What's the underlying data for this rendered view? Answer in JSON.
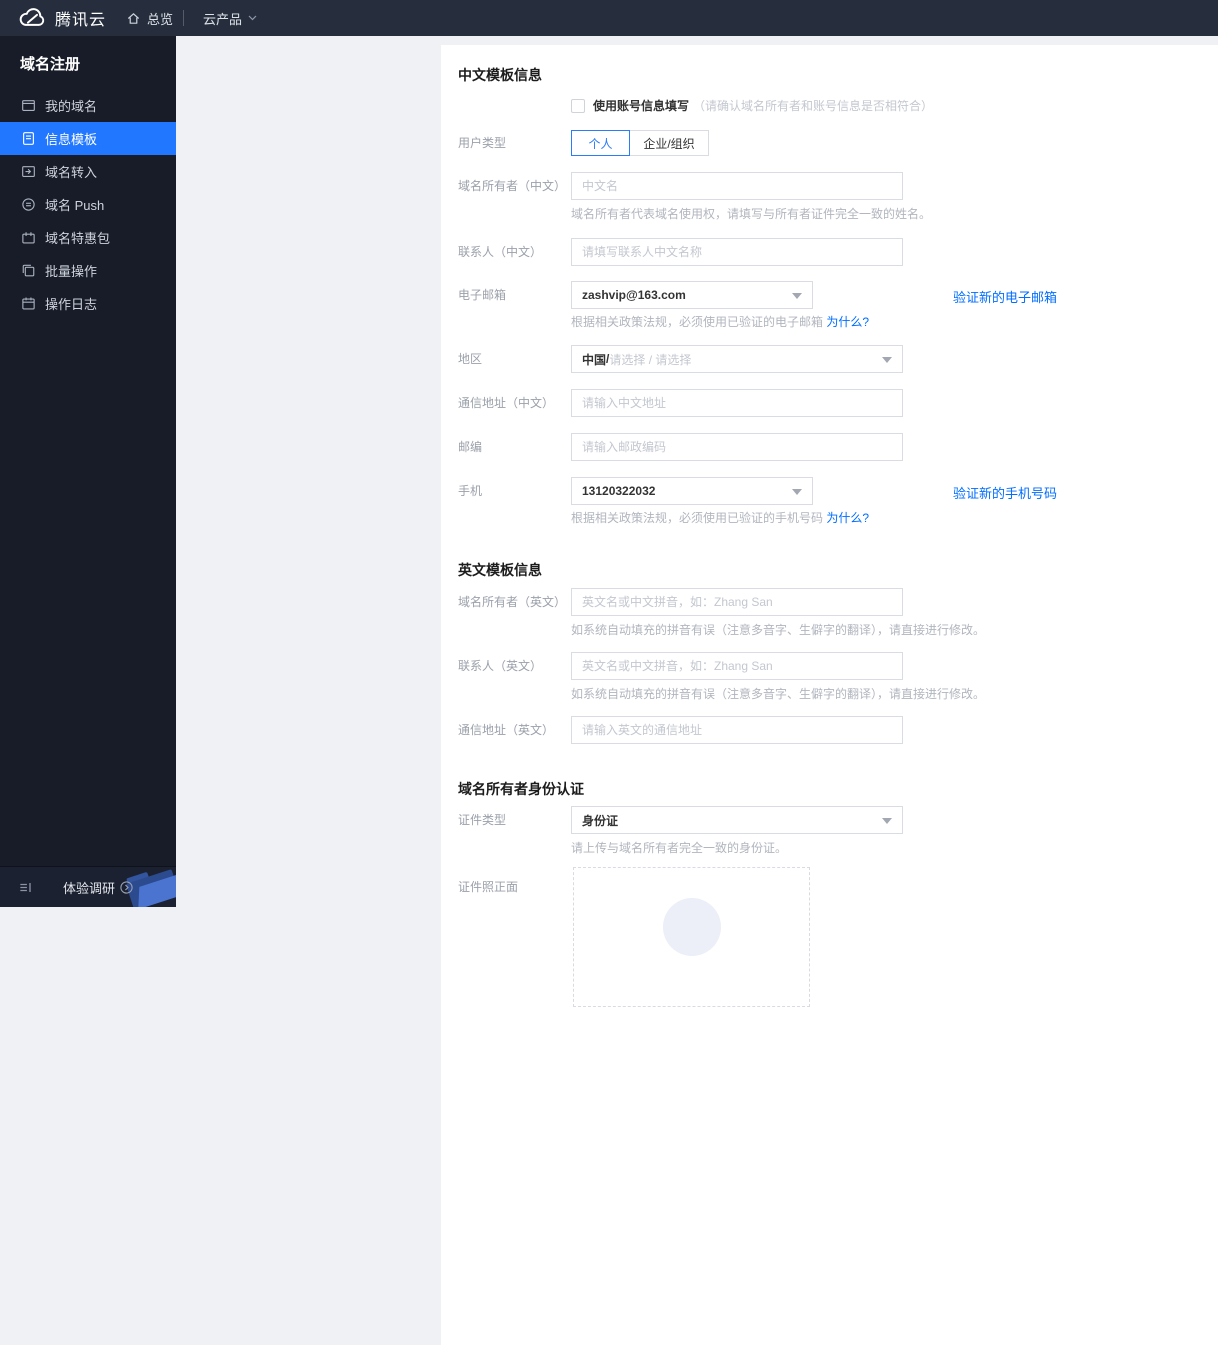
{
  "colors": {
    "accent": "#2b7cf8",
    "sidebar_active": "#2177ff",
    "link": "#006eff",
    "topbar_bg": "#262e3d",
    "sidebar_bg": "#171c28"
  },
  "topbar": {
    "brand": "腾讯云",
    "overview": "总览",
    "products": "云产品"
  },
  "sidebar": {
    "title": "域名注册",
    "items": [
      {
        "label": "我的域名"
      },
      {
        "label": "信息模板"
      },
      {
        "label": "域名转入"
      },
      {
        "label": "域名 Push"
      },
      {
        "label": "域名特惠包"
      },
      {
        "label": "批量操作"
      },
      {
        "label": "操作日志"
      }
    ],
    "survey_label": "体验调研"
  },
  "form": {
    "cn": {
      "title": "中文模板信息",
      "use_account": {
        "label": "使用账号信息填写",
        "note": "（请确认域名所有者和账号信息是否相符合）"
      },
      "user_type": {
        "label": "用户类型",
        "personal": "个人",
        "org": "企业/组织"
      },
      "owner": {
        "label": "域名所有者（中文）",
        "placeholder": "中文名",
        "help": "域名所有者代表域名使用权，请填写与所有者证件完全一致的姓名。"
      },
      "contact": {
        "label": "联系人（中文）",
        "placeholder": "请填写联系人中文名称"
      },
      "email": {
        "label": "电子邮箱",
        "value": "zashvip@163.com",
        "action": "验证新的电子邮箱",
        "help": "根据相关政策法规，必须使用已验证的电子邮箱",
        "why": "为什么?"
      },
      "region": {
        "label": "地区",
        "selected": "中国",
        "separator": " / ",
        "placeholder": "请选择 / 请选择"
      },
      "address": {
        "label": "通信地址（中文）",
        "placeholder": "请输入中文地址"
      },
      "postcode": {
        "label": "邮编",
        "placeholder": "请输入邮政编码"
      },
      "phone": {
        "label": "手机",
        "value": "13120322032",
        "action": "验证新的手机号码",
        "help": "根据相关政策法规，必须使用已验证的手机号码",
        "why": "为什么?"
      }
    },
    "en": {
      "title": "英文模板信息",
      "owner": {
        "label": "域名所有者（英文）",
        "placeholder": "英文名或中文拼音，如：Zhang San",
        "help": "如系统自动填充的拼音有误（注意多音字、生僻字的翻译），请直接进行修改。"
      },
      "contact": {
        "label": "联系人（英文）",
        "placeholder": "英文名或中文拼音，如：Zhang San",
        "help": "如系统自动填充的拼音有误（注意多音字、生僻字的翻译），请直接进行修改。"
      },
      "address": {
        "label": "通信地址（英文）",
        "placeholder": "请输入英文的通信地址"
      }
    },
    "identity": {
      "title": "域名所有者身份认证",
      "cert_type": {
        "label": "证件类型",
        "value": "身份证",
        "help": "请上传与域名所有者完全一致的身份证。"
      },
      "cert_front": {
        "label": "证件照正面"
      }
    }
  }
}
